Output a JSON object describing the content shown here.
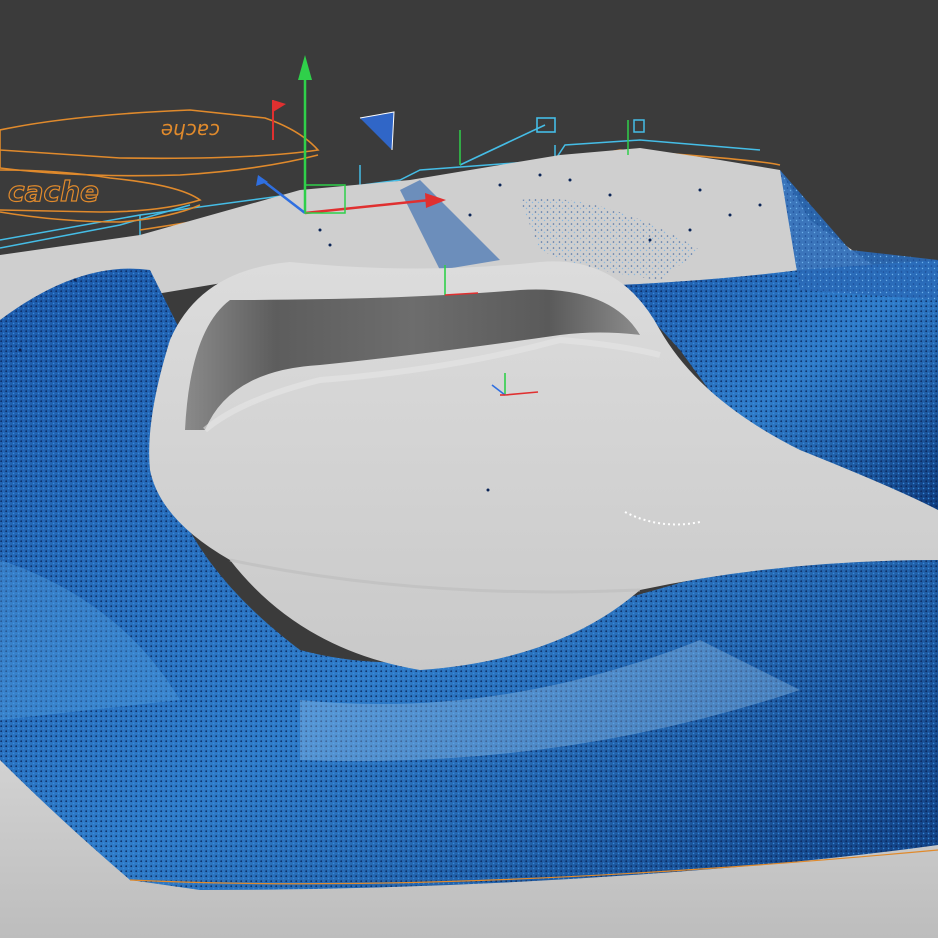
{
  "viewport": {
    "background": "#3b3b3b",
    "surface_color": "#cfcfcf",
    "particle_colors": [
      "#0b2a6b",
      "#1a4f9c",
      "#2b78c9",
      "#5aa6e6",
      "#9fc9ef",
      "#ffffff"
    ]
  },
  "cache_labels": [
    {
      "text": "cache",
      "color": "#e08a2c"
    },
    {
      "text": "cache",
      "color": "#e08a2c"
    }
  ],
  "gizmos": [
    {
      "name": "main-transform-gizmo",
      "x_color": "#e03030",
      "y_color": "#2fd04a",
      "z_color": "#2f6fe0"
    },
    {
      "name": "center-pivot-gizmo",
      "x_color": "#e03030",
      "y_color": "#2fd04a",
      "z_color": "#2f6fe0"
    },
    {
      "name": "upper-pivot-gizmo",
      "x_color": "#e03030",
      "y_color": "#2fd04a",
      "z_color": "#2f6fe0"
    }
  ],
  "helper_icons": [
    "flag-icon",
    "camera-icon",
    "emitter-icon",
    "emitter-icon"
  ],
  "bounding_box_colors": {
    "cyan": "#45bde6",
    "orange": "#e08a2c"
  }
}
